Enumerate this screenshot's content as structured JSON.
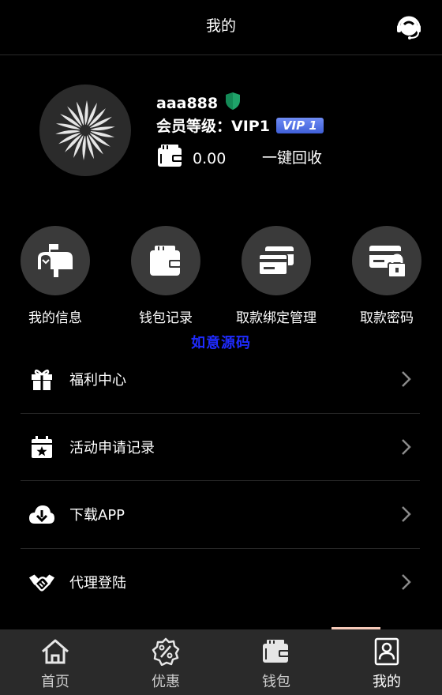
{
  "header": {
    "title": "我的"
  },
  "profile": {
    "username": "aaa888",
    "level_label": "会员等级：VIP1",
    "vip_badge": "VIP 1",
    "balance": "0.00",
    "recycle_label": "一键回收"
  },
  "quick_actions": [
    {
      "label": "我的信息",
      "icon": "mailbox-icon"
    },
    {
      "label": "钱包记录",
      "icon": "wallet-icon"
    },
    {
      "label": "取款绑定管理",
      "icon": "cards-icon"
    },
    {
      "label": "取款密码",
      "icon": "card-lock-icon"
    }
  ],
  "watermark": "如意源码",
  "menu": [
    {
      "label": "福利中心",
      "icon": "gift-icon"
    },
    {
      "label": "活动申请记录",
      "icon": "calendar-star-icon"
    },
    {
      "label": "下载APP",
      "icon": "cloud-download-icon"
    },
    {
      "label": "代理登陆",
      "icon": "handshake-icon"
    }
  ],
  "tabbar": [
    {
      "label": "首页",
      "icon": "home-icon"
    },
    {
      "label": "优惠",
      "icon": "discount-icon"
    },
    {
      "label": "钱包",
      "icon": "wallet-icon"
    },
    {
      "label": "我的",
      "icon": "profile-icon",
      "active": true
    }
  ],
  "colors": {
    "accent_vip": "#4f6fe6",
    "tab_indicator": "#f6c9b8",
    "watermark": "#1f2bff"
  }
}
